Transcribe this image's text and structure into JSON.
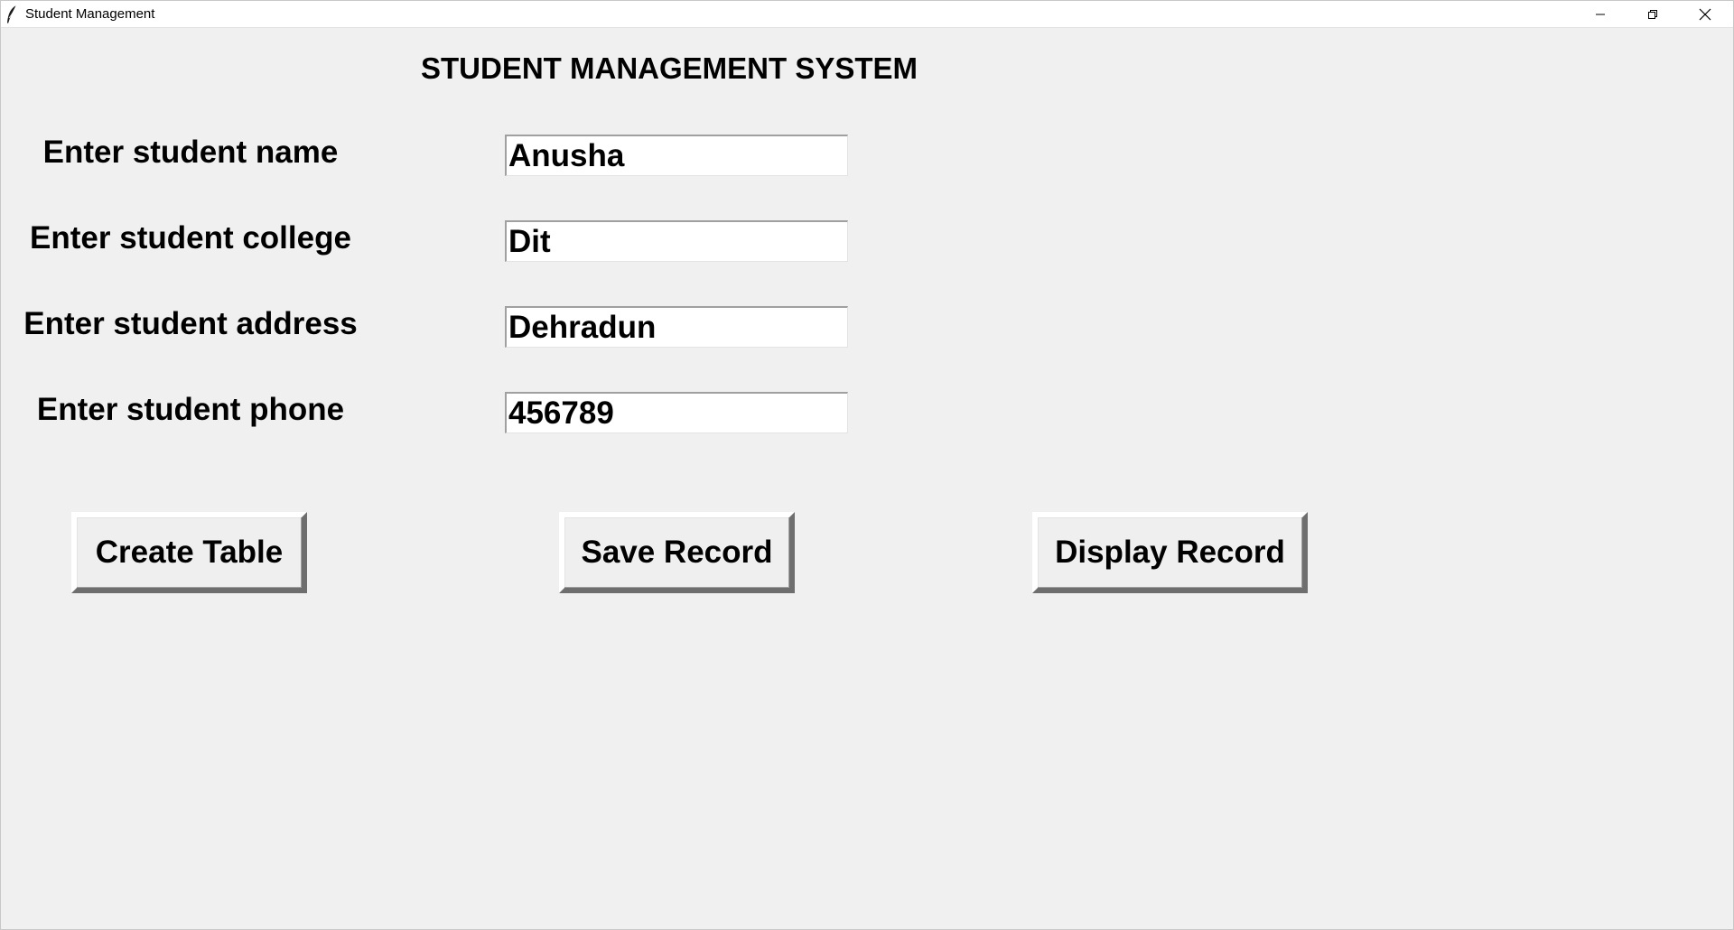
{
  "window": {
    "title": "Student Management",
    "controls": {
      "minimize": "minimize-icon",
      "maximize": "restore-icon",
      "close": "close-icon"
    }
  },
  "heading": "STUDENT MANAGEMENT SYSTEM",
  "form": {
    "name_label": "Enter student name",
    "name_value": "Anusha",
    "college_label": "Enter student college",
    "college_value": "Dit",
    "address_label": "Enter student address",
    "address_value": "Dehradun",
    "phone_label": "Enter student phone",
    "phone_value": "456789"
  },
  "buttons": {
    "create": "Create Table",
    "save": "Save Record",
    "display": "Display Record"
  },
  "colors": {
    "background": "#f0f0f0",
    "entry_background": "#ffffff",
    "text": "#000000"
  }
}
